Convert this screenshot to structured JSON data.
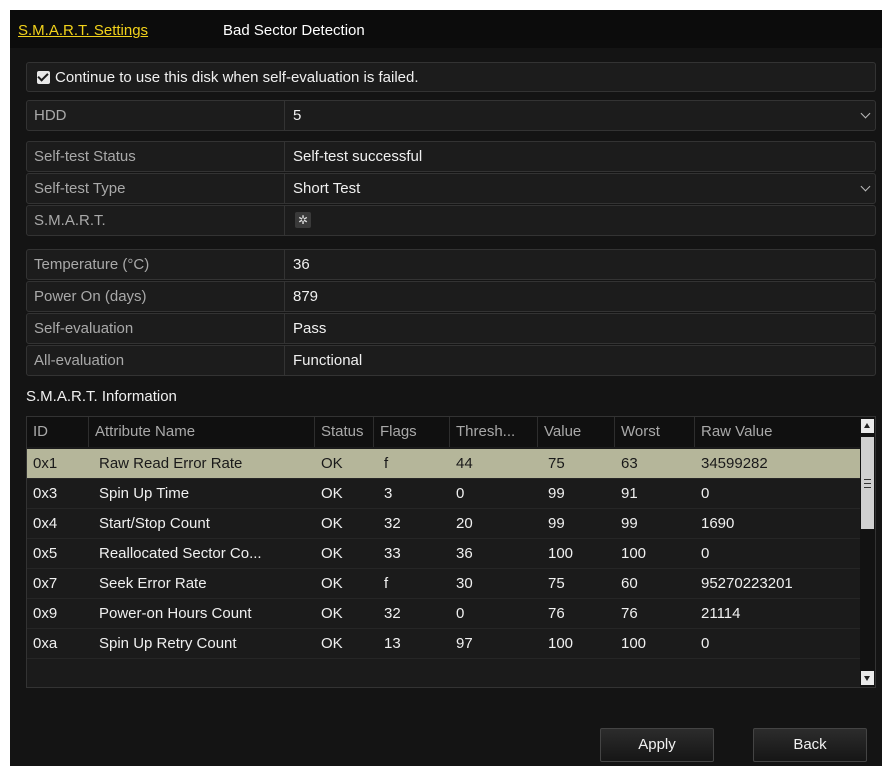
{
  "tabs": [
    {
      "label": "S.M.A.R.T. Settings",
      "active": true
    },
    {
      "label": "Bad Sector Detection",
      "active": false
    }
  ],
  "continue_checkbox": {
    "label": "Continue to use this disk when self-evaluation is failed.",
    "checked": true
  },
  "fields": {
    "hdd": {
      "label": "HDD",
      "value": "5"
    },
    "self_test_status": {
      "label": "Self-test Status",
      "value": "Self-test successful"
    },
    "self_test_type": {
      "label": "Self-test Type",
      "value": "Short Test"
    },
    "smart": {
      "label": "S.M.A.R.T."
    },
    "temperature": {
      "label": "Temperature (°C)",
      "value": "36"
    },
    "power_on": {
      "label": "Power On (days)",
      "value": "879"
    },
    "self_evaluation": {
      "label": "Self-evaluation",
      "value": "Pass"
    },
    "all_evaluation": {
      "label": "All-evaluation",
      "value": "Functional"
    }
  },
  "smart_info": {
    "title": "S.M.A.R.T. Information",
    "columns": [
      "ID",
      "Attribute Name",
      "Status",
      "Flags",
      "Thresh...",
      "Value",
      "Worst",
      "Raw Value"
    ],
    "rows": [
      [
        "0x1",
        "Raw Read Error Rate",
        "OK",
        "f",
        "44",
        "75",
        "63",
        "34599282"
      ],
      [
        "0x3",
        "Spin Up Time",
        "OK",
        "3",
        "0",
        "99",
        "91",
        "0"
      ],
      [
        "0x4",
        "Start/Stop Count",
        "OK",
        "32",
        "20",
        "99",
        "99",
        "1690"
      ],
      [
        "0x5",
        "Reallocated Sector Co...",
        "OK",
        "33",
        "36",
        "100",
        "100",
        "0"
      ],
      [
        "0x7",
        "Seek Error Rate",
        "OK",
        "f",
        "30",
        "75",
        "60",
        "95270223201"
      ],
      [
        "0x9",
        "Power-on Hours Count",
        "OK",
        "32",
        "0",
        "76",
        "76",
        "21114"
      ],
      [
        "0xa",
        "Spin Up Retry Count",
        "OK",
        "13",
        "97",
        "100",
        "100",
        "0"
      ]
    ],
    "selected_row": 0
  },
  "buttons": {
    "apply": "Apply",
    "back": "Back"
  },
  "colors": {
    "active_tab": "#f2d21b",
    "selected_row": "#b5b69a"
  }
}
